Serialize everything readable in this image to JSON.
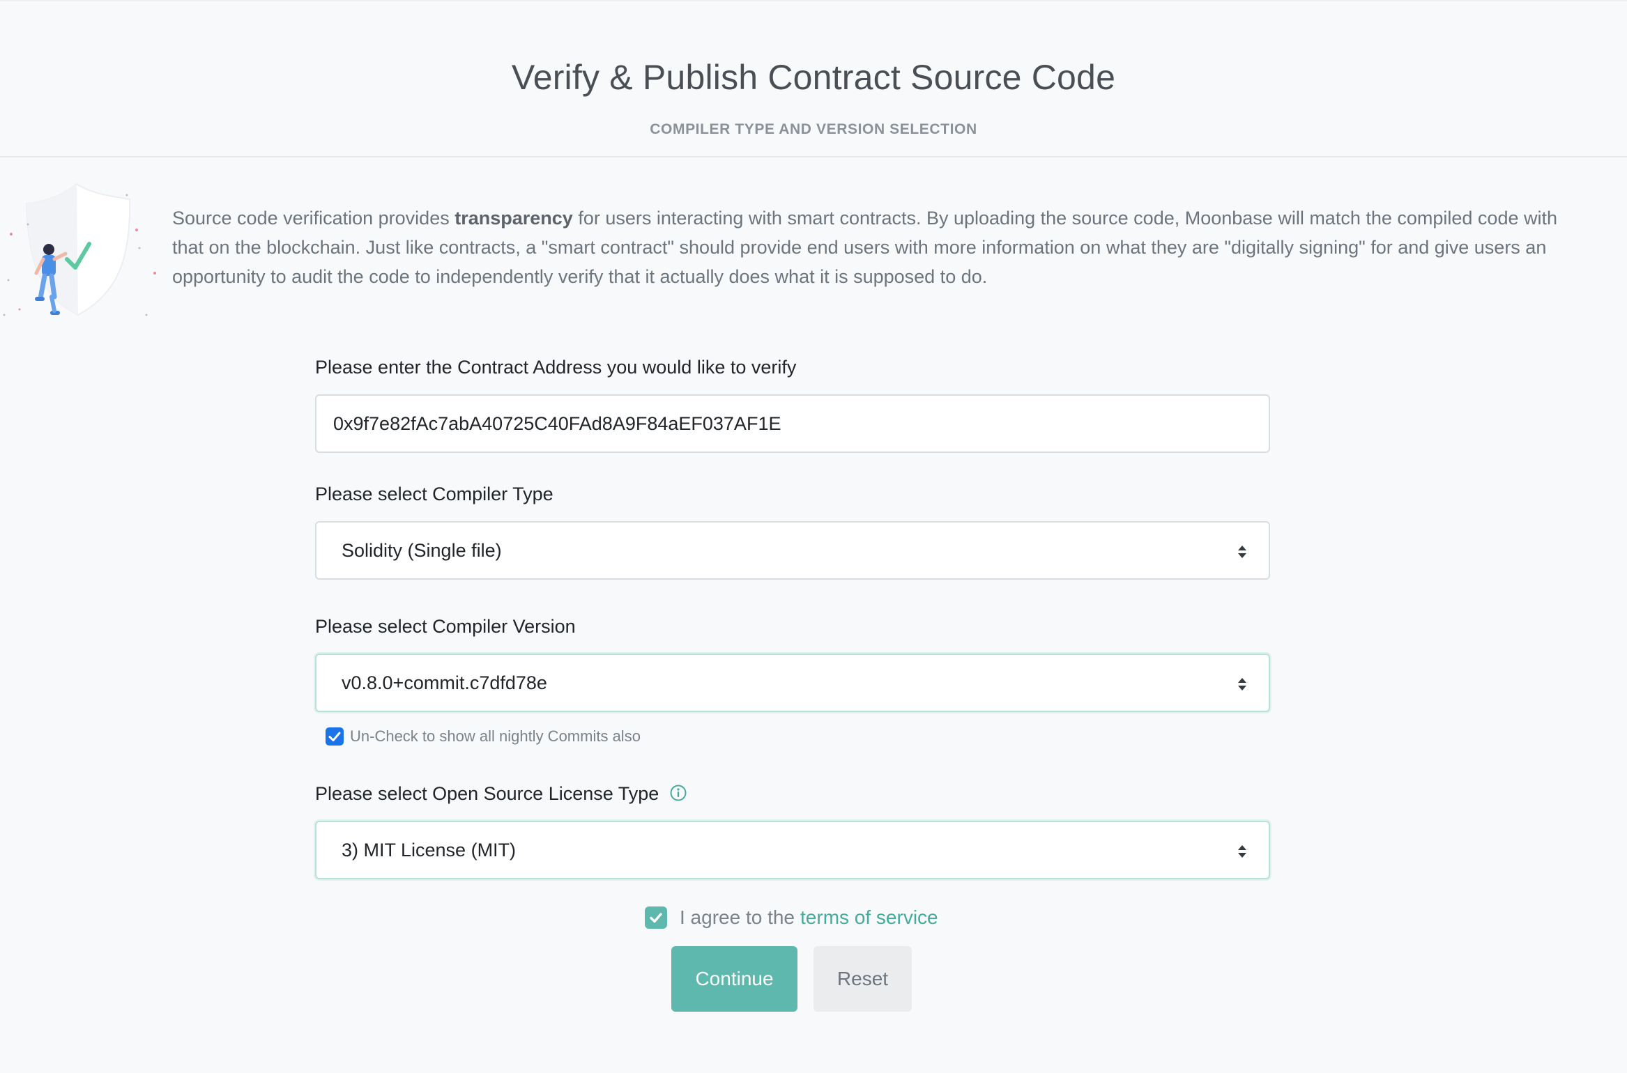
{
  "header": {
    "title": "Verify & Publish Contract Source Code",
    "subtitle": "COMPILER TYPE AND VERSION SELECTION"
  },
  "intro": {
    "prefix": "Source code verification provides ",
    "bold": "transparency",
    "suffix": " for users interacting with smart contracts. By uploading the source code, Moonbase will match the compiled code with that on the blockchain. Just like contracts, a \"smart contract\" should provide end users with more information on what they are \"digitally signing\" for and give users an opportunity to audit the code to independently verify that it actually does what it is supposed to do."
  },
  "address": {
    "label": "Please enter the Contract Address you would like to verify",
    "value": "0x9f7e82fAc7abA40725C40FAd8A9F84aEF037AF1E"
  },
  "compiler_type": {
    "label": "Please select Compiler Type",
    "selected": "Solidity (Single file)"
  },
  "compiler_version": {
    "label": "Please select Compiler Version",
    "selected": "v0.8.0+commit.c7dfd78e",
    "nightly_label": "Un-Check to show all nightly Commits also",
    "nightly_checked": true
  },
  "license": {
    "label": "Please select Open Source License Type",
    "selected": "3) MIT License (MIT)",
    "icon": "info-icon"
  },
  "agreement": {
    "text": "I agree to the",
    "link": "terms of service",
    "checked": true
  },
  "buttons": {
    "continue": "Continue",
    "reset": "Reset"
  },
  "colors": {
    "accent": "#5fb8ad",
    "link": "#46aa9c",
    "checkbox_blue": "#1a73e8",
    "background": "#f8f9fa"
  }
}
